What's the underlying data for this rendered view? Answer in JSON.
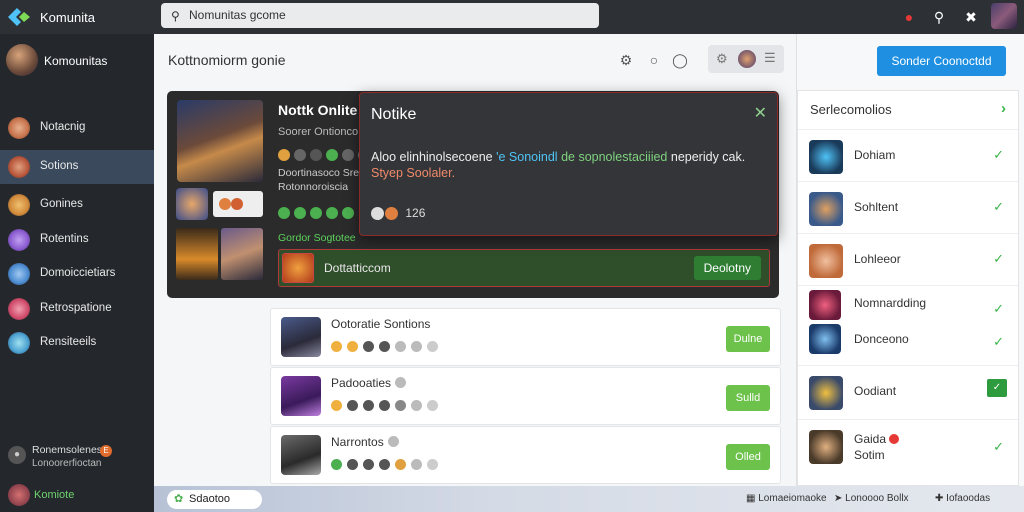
{
  "app": {
    "title": "Komunita"
  },
  "search": {
    "placeholder": "Nomunitas gcome",
    "value": "Nomunitas gcome"
  },
  "sidebar": {
    "user": "Komounitas",
    "items": [
      {
        "label": "Notacnig",
        "color": "#c6724a"
      },
      {
        "label": "Sotions",
        "color": "#b8563a",
        "active": true
      },
      {
        "label": "Gonines",
        "color": "#d08a3a"
      },
      {
        "label": "Rotentins",
        "color": "#8a5ad0"
      },
      {
        "label": "Domoiccietiars",
        "color": "#4a8ad0"
      },
      {
        "label": "Retrospatione",
        "color": "#d04a6a"
      },
      {
        "label": "Rensiteeils",
        "color": "#4aa0d0"
      }
    ],
    "footer_line1": "Ronemsolenes",
    "footer_line2": "Lonoorerfioctan",
    "footer_badge": "E",
    "bottom_user": "Komiote"
  },
  "main": {
    "title": "Kottnomiorm gonie",
    "featured": {
      "title": "Nottk Onlite",
      "subtitle": "Soorer Ontionco",
      "desc_line1": "Doortinasoco Sretioo",
      "desc_line2": "Rotonnoroiscia",
      "tag": "Gordor Sogtotee",
      "bar_label": "Dottatticcom",
      "bar_button": "Deolotny"
    },
    "cards": [
      {
        "name": "Ootoratie Sontions",
        "button": "Dulne"
      },
      {
        "name": "Padooaties",
        "button": "Sulld"
      },
      {
        "name": "Narrontos",
        "button": "Olled"
      }
    ]
  },
  "modal": {
    "title": "Notike",
    "text_a": "Aloo elinhinolsecoene",
    "text_b": "'e Sonoindl",
    "text_c": "de sopnolestaciiied",
    "text_d": "neperidy cak.",
    "text_e": "Styep Soolaler.",
    "count": "126"
  },
  "bottombar": {
    "pill": "Sdaotoo",
    "item1": "Lomaeiomaoke",
    "item2": "Lonoooo Bollx",
    "item3": "Iofaoodas"
  },
  "right": {
    "cta": "Sonder Coonoctdd",
    "panel_title": "Serlecomolios",
    "rows": [
      {
        "name": "Dohiam",
        "status": "check"
      },
      {
        "name": "Sohltent",
        "status": "check"
      },
      {
        "name": "Lohleeor",
        "status": "check"
      },
      {
        "name": "Nomnardding",
        "status": "check"
      },
      {
        "name": "Donceono",
        "status": "check"
      },
      {
        "name": "Oodiant",
        "status": "box"
      },
      {
        "name": "Gaida",
        "name2": "Sotim",
        "status": "check"
      }
    ]
  }
}
